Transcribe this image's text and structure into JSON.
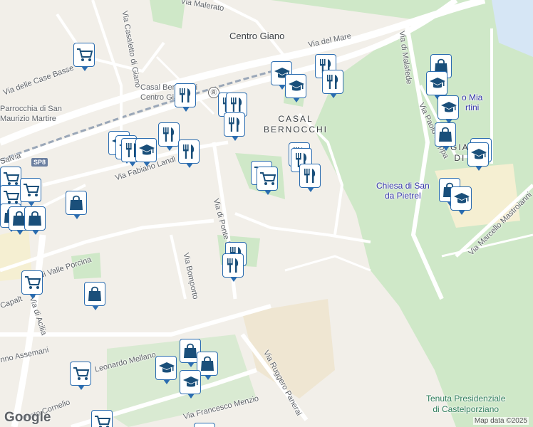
{
  "map": {
    "logo": "Google",
    "copyright": "Map data ©2025",
    "colors": {
      "land": "#f2efe9",
      "park": "#cfe8c8",
      "road": "#ffffff",
      "rail": "#9aa7b8",
      "pin_border": "#2a6cb0",
      "icon": "#1a4f7a"
    }
  },
  "labels": {
    "via_malerato": "Via Malerato",
    "centro_giano": "Centro Giano",
    "via_del_mare": "Via del Mare",
    "via_di_malafede": "Via di Malafede",
    "via_casaletto": "Via Casaletto di Giano",
    "case_basse": "Via delle Case Basse",
    "parrocchia": "Parrocchia di San\nMaurizio Martire",
    "casal_bernocchi_station": "Casal Bernocchi\nCentro Giano",
    "casal_bernocchi_area": "CASAL\nBERNOCCHI",
    "via_salvia": "Salvia",
    "sp8": "SP8",
    "via_fabiano_landi": "Via Fabiano Landi",
    "via_ponte_ladrone": "Via di Ponte Ladrone",
    "via_paolo_stoppa": "Via Paolo Stoppa",
    "chiesa": "Chiesa di San\nda Pietrel",
    "mia_martini": "o Mia\nrtini",
    "gia_di": "GIA\nDI",
    "via_marcello_mastroianni": "Via Marcello Mastroianni",
    "via_valle_porcina": "Via di Valle Porcina",
    "via_bomporto": "Via Bomporto",
    "capalt": "Capalt",
    "via_di_acilia": "Via di Acilia",
    "assemani": "nno Assemani",
    "leonardo_mellano": "Leonardo Mellano",
    "via_ruggero_panerai": "Via Ruggero Panerai",
    "via_francesco_menzio": "Via Francesco Menzio",
    "prato_cornelio": "Prato Cornelio",
    "tenuta": "Tenuta Presidenziale\ndi Castelporziano"
  },
  "pin_types": [
    "restaurant-pin",
    "school-pin",
    "shopping-bag-pin",
    "supermarket-pin"
  ]
}
